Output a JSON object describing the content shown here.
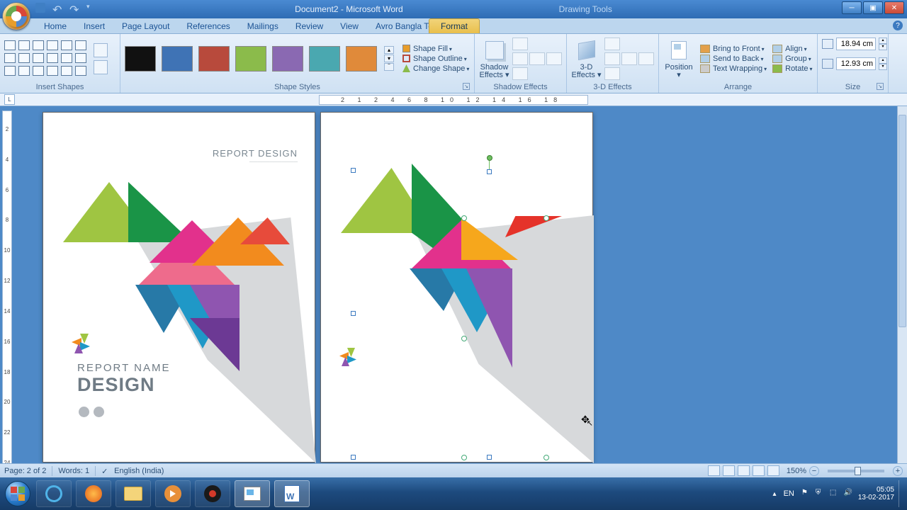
{
  "titlebar": {
    "doc_title": "Document2 - Microsoft Word",
    "context_title": "Drawing Tools"
  },
  "win": {
    "min": "─",
    "max": "▣",
    "close": "✕"
  },
  "tabs": {
    "home": "Home",
    "insert": "Insert",
    "page_layout": "Page Layout",
    "references": "References",
    "mailings": "Mailings",
    "review": "Review",
    "view": "View",
    "avro": "Avro Bangla Tools",
    "format": "Format"
  },
  "ribbon": {
    "insert_shapes": {
      "label": "Insert Shapes"
    },
    "shape_styles": {
      "label": "Shape Styles",
      "fill": "Shape Fill",
      "outline": "Shape Outline",
      "change": "Change Shape",
      "swatches": [
        "#111111",
        "#3f73b5",
        "#b84a3c",
        "#8bbb4b",
        "#8a69b2",
        "#4aa8b0",
        "#e08a3a"
      ]
    },
    "shadow": {
      "label": "Shadow Effects",
      "btn1": "Shadow",
      "btn2": "Effects ▾"
    },
    "threed": {
      "label": "3-D Effects",
      "btn1": "3-D",
      "btn2": "Effects ▾"
    },
    "arrange": {
      "label": "Arrange",
      "position": "Position",
      "front": "Bring to Front",
      "back": "Send to Back",
      "wrap": "Text Wrapping",
      "align": "Align",
      "group": "Group",
      "rotate": "Rotate"
    },
    "size": {
      "label": "Size",
      "h": "18.94 cm",
      "w": "12.93 cm"
    }
  },
  "ruler": {
    "marks": "2   1   2   4   6   8   10   12   14   16   18"
  },
  "vruler": [
    "2",
    "4",
    "6",
    "8",
    "10",
    "12",
    "14",
    "16",
    "18",
    "20",
    "22",
    "24"
  ],
  "page1": {
    "title": "REPORT DESIGN",
    "report_name": "REPORT NAME",
    "design": "DESIGN"
  },
  "status": {
    "page": "Page: 2 of 2",
    "words": "Words: 1",
    "lang": "English (India)",
    "zoom": "150%"
  },
  "tray": {
    "lang": "EN",
    "time": "05:05",
    "date": "13-02-2017"
  }
}
